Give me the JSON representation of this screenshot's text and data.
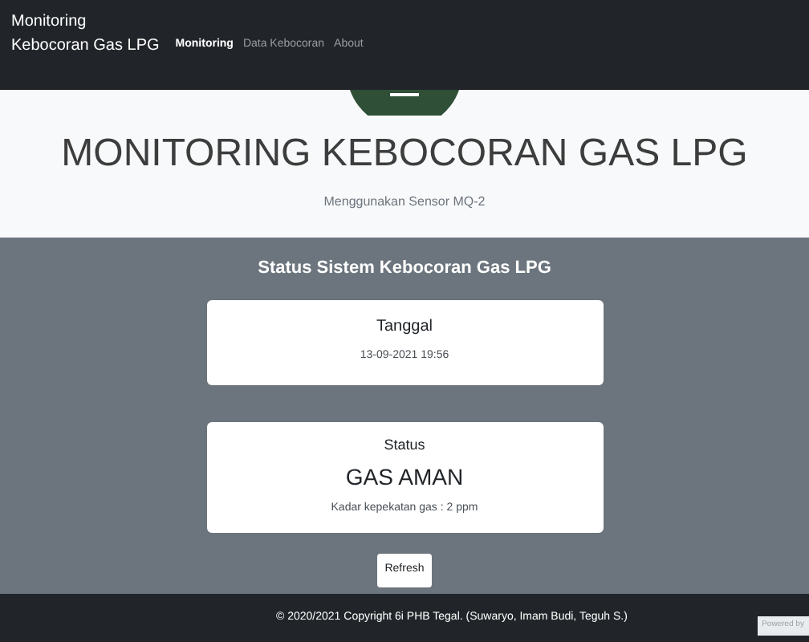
{
  "navbar": {
    "brand": [
      "Monitoring",
      "Kebocoran Gas LPG"
    ],
    "links": [
      {
        "label": "Monitoring",
        "selected": true
      },
      {
        "label": "Data Kebocoran",
        "selected": false
      },
      {
        "label": "About",
        "selected": false
      }
    ]
  },
  "hero": {
    "title": "MONITORING KEBOCORAN GAS LPG",
    "subtitle": "Menggunakan Sensor MQ-2"
  },
  "status": {
    "heading": "Status Sistem Kebocoran Gas LPG",
    "date_card": {
      "label": "Tanggal",
      "value": "13-09-2021 19:56"
    },
    "status_card": {
      "label": "Status",
      "value": "GAS AMAN",
      "detail": "Kadar kepekatan gas : 2 ppm"
    },
    "button": "Refresh"
  },
  "footer": {
    "copyright": "© 2020/2021 Copyright 6i PHB Tegal. (Suwaryo, Imam Budi, Teguh S.)",
    "badge": "Powered by"
  }
}
